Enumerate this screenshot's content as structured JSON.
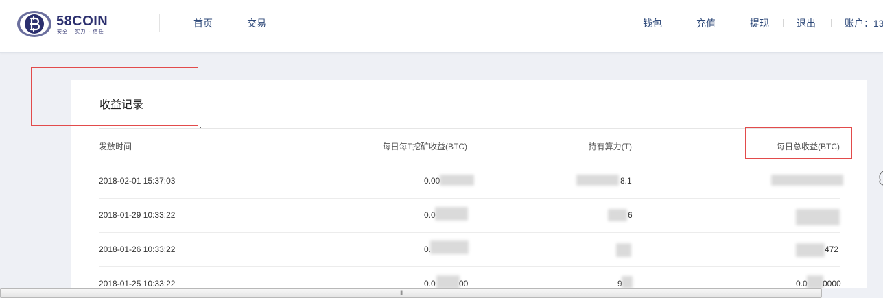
{
  "brand": {
    "name": "58COIN",
    "slogan": "安全 · 实力 · 信任",
    "logo_letter": "B",
    "color": "#2b2f6e"
  },
  "nav": {
    "home": "首页",
    "trade": "交易",
    "wallet": "钱包",
    "deposit": "充值",
    "withdraw": "提现",
    "logout": "退出",
    "account": "账户：13",
    "link_color": "#2f4a7a"
  },
  "earnings": {
    "title": "收益记录",
    "columns": {
      "time": "发放时间",
      "per_t": "每日每T挖矿收益(BTC)",
      "hashrate": "持有算力(T)",
      "total": "每日总收益(BTC)"
    },
    "rows": [
      {
        "time": "2018-02-01 15:37:03",
        "per_t": "0.00",
        "hashrate": "8.1",
        "total": ""
      },
      {
        "time": "2018-01-29 10:33:22",
        "per_t": "0.0",
        "hashrate": "6",
        "total": ""
      },
      {
        "time": "2018-01-26 10:33:22",
        "per_t": "0.",
        "hashrate": "",
        "total": "472"
      },
      {
        "time": "2018-01-25 10:33:22",
        "per_t": "0.0",
        "hashrate": "9",
        "total": "0.0"
      }
    ],
    "row3_per_t_suffix": "00",
    "row4_total_suffix": "0000"
  },
  "scrollbar": {
    "grip": "III"
  },
  "colors": {
    "page_bg": "#eef0f5",
    "annotation": "#e24b4b",
    "redaction": "#d4d4d4"
  }
}
